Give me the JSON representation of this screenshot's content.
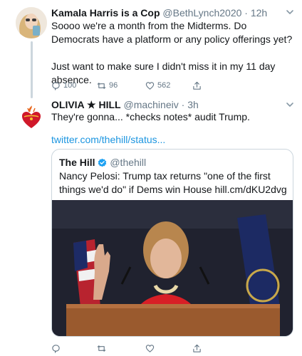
{
  "tweets": [
    {
      "display_name": "Kamala Harris is a Cop",
      "handle": "@BethLynch2020",
      "separator": " · ",
      "time": "12h",
      "text": "Soooo we're a month from the Midterms. Do Democrats have a platform or any policy offerings yet?\n\nJust want to make sure I didn't miss it in my 11 day absence.",
      "replies": "100",
      "retweets": "96",
      "likes": "562"
    },
    {
      "display_name": "OLIVIA ★ HILL",
      "handle": "@machineiv",
      "separator": " · ",
      "time": "3h",
      "text": "They're gonna... *checks notes* audit Trump.",
      "link": "twitter.com/thehill/status...",
      "quoted": {
        "display_name": "The Hill",
        "handle": "@thehill",
        "text": "Nancy Pelosi: Trump tax returns \"one of the first things we'd do\" if Dems win House hill.cm/dKU2dvg"
      }
    }
  ],
  "colors": {
    "link": "#1b95e0",
    "verified": "#1da1f2",
    "muted": "#657786",
    "border": "#ccd6dd"
  },
  "icons": {
    "reply": "reply-icon",
    "retweet": "retweet-icon",
    "like": "heart-icon",
    "share": "share-icon",
    "menu": "chevron-down-icon",
    "verified": "verified-badge-icon"
  }
}
